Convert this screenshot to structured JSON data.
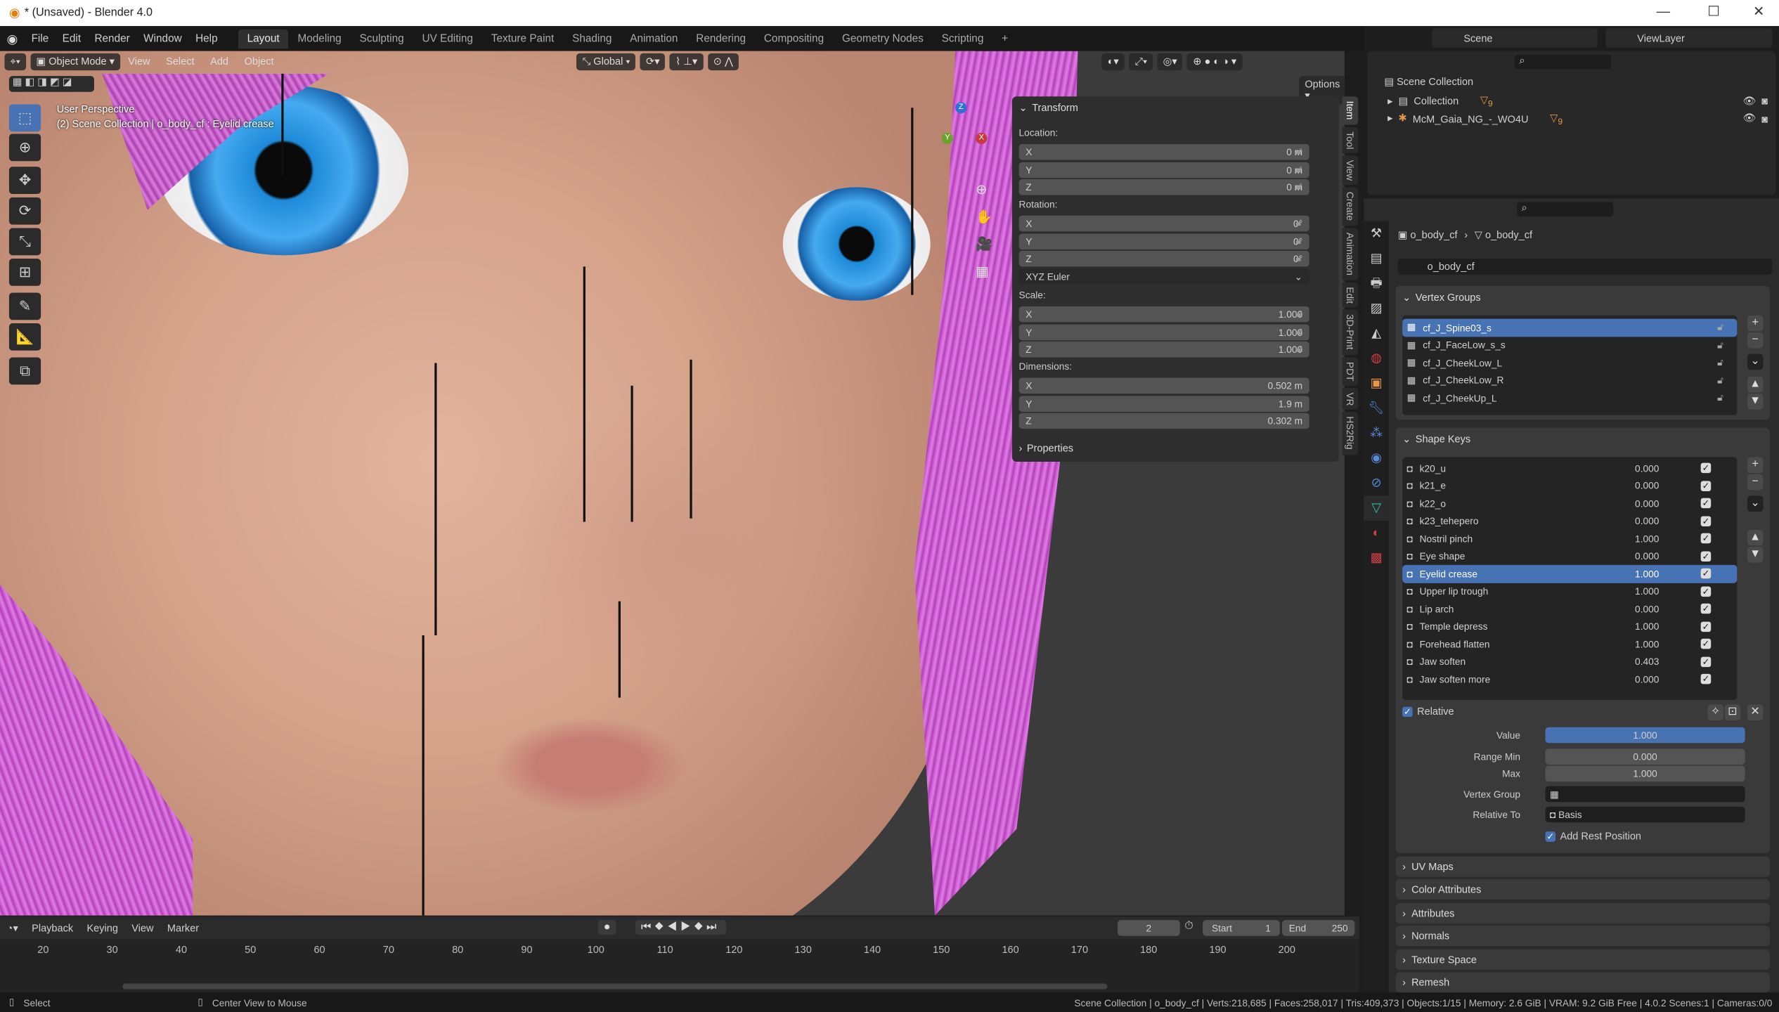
{
  "window": {
    "title": "* (Unsaved) - Blender 4.0",
    "minimize": "—",
    "maximize": "☐",
    "close": "✕"
  },
  "menu": {
    "items": [
      "File",
      "Edit",
      "Render",
      "Window",
      "Help"
    ],
    "workspaces": [
      "Layout",
      "Modeling",
      "Sculpting",
      "UV Editing",
      "Texture Paint",
      "Shading",
      "Animation",
      "Rendering",
      "Compositing",
      "Geometry Nodes",
      "Scripting"
    ],
    "active_workspace": "Layout",
    "add": "+"
  },
  "viewport": {
    "mode": "Object Mode",
    "menus": [
      "View",
      "Select",
      "Add",
      "Object"
    ],
    "orientation": "Global",
    "options": "Options",
    "perspective": "User Perspective",
    "info": "(2) Scene Collection | o_body_cf : Eyelid crease",
    "gizmo": {
      "z": "Z",
      "y": "Y",
      "x": "X"
    }
  },
  "npanel": {
    "title": "Transform",
    "location_label": "Location:",
    "rotation_label": "Rotation:",
    "scale_label": "Scale:",
    "dimensions_label": "Dimensions:",
    "location": [
      {
        "axis": "X",
        "value": "0 m"
      },
      {
        "axis": "Y",
        "value": "0 m"
      },
      {
        "axis": "Z",
        "value": "0 m"
      }
    ],
    "rotation": [
      {
        "axis": "X",
        "value": "0°"
      },
      {
        "axis": "Y",
        "value": "0°"
      },
      {
        "axis": "Z",
        "value": "0°"
      }
    ],
    "rotation_mode": "XYZ Euler",
    "scale": [
      {
        "axis": "X",
        "value": "1.000"
      },
      {
        "axis": "Y",
        "value": "1.000"
      },
      {
        "axis": "Z",
        "value": "1.000"
      }
    ],
    "dimensions": [
      {
        "axis": "X",
        "value": "0.502 m"
      },
      {
        "axis": "Y",
        "value": "1.9 m"
      },
      {
        "axis": "Z",
        "value": "0.302 m"
      }
    ],
    "properties": "Properties",
    "tabs": [
      "Item",
      "Tool",
      "View",
      "Create",
      "Animation",
      "Edit",
      "3D-Print",
      "PDT",
      "VR",
      "HS2Rig"
    ],
    "active_tab": "Item"
  },
  "topright": {
    "scene": "Scene",
    "viewlayer": "ViewLayer"
  },
  "outliner": {
    "scene_collection": "Scene Collection",
    "rows": [
      {
        "name": "Collection",
        "badge": "9"
      },
      {
        "name": "McM_Gaia_NG_-_WO4U",
        "badge": "9"
      }
    ]
  },
  "properties": {
    "breadcrumb": [
      "o_body_cf",
      "o_body_cf"
    ],
    "mesh_name": "o_body_cf",
    "vertex_groups_title": "Vertex Groups",
    "vertex_groups": [
      "cf_J_Spine03_s",
      "cf_J_FaceLow_s_s",
      "cf_J_CheekLow_L",
      "cf_J_CheekLow_R",
      "cf_J_CheekUp_L"
    ],
    "vertex_group_selected": 0,
    "shape_keys_title": "Shape Keys",
    "shape_keys": [
      {
        "name": "k20_u",
        "value": "0.000"
      },
      {
        "name": "k21_e",
        "value": "0.000"
      },
      {
        "name": "k22_o",
        "value": "0.000"
      },
      {
        "name": "k23_tehepero",
        "value": "0.000"
      },
      {
        "name": "Nostril pinch",
        "value": "1.000"
      },
      {
        "name": "Eye shape",
        "value": "0.000"
      },
      {
        "name": "Eyelid crease",
        "value": "1.000"
      },
      {
        "name": "Upper lip trough",
        "value": "1.000"
      },
      {
        "name": "Lip arch",
        "value": "0.000"
      },
      {
        "name": "Temple depress",
        "value": "1.000"
      },
      {
        "name": "Forehead flatten",
        "value": "1.000"
      },
      {
        "name": "Jaw soften",
        "value": "0.403"
      },
      {
        "name": "Jaw soften more",
        "value": "0.000"
      }
    ],
    "shape_key_selected": 6,
    "relative": "Relative",
    "value_label": "Value",
    "value": "1.000",
    "value_fraction": 1.0,
    "range_min_label": "Range Min",
    "range_min": "0.000",
    "max_label": "Max",
    "max": "1.000",
    "vertex_group_label": "Vertex Group",
    "vertex_group_value": "",
    "relative_to_label": "Relative To",
    "relative_to": "Basis",
    "add_rest_position": "Add Rest Position",
    "collapsed_panels": [
      "UV Maps",
      "Color Attributes",
      "Attributes",
      "Normals",
      "Texture Space",
      "Remesh"
    ]
  },
  "timeline": {
    "menus": [
      "Playback",
      "Keying",
      "View",
      "Marker"
    ],
    "current_frame": "2",
    "start_label": "Start",
    "start": "1",
    "end_label": "End",
    "end": "250",
    "ticks": [
      "20",
      "30",
      "40",
      "50",
      "60",
      "70",
      "80",
      "90",
      "100",
      "110",
      "120",
      "130",
      "140",
      "150",
      "160",
      "170",
      "180",
      "190",
      "200"
    ]
  },
  "status": {
    "left": [
      "Select",
      "Center View to Mouse"
    ],
    "right": "Scene Collection | o_body_cf | Verts:218,685 | Faces:258,017 | Tris:409,373 | Objects:1/15 | Memory: 2.6 GiB | VRAM: 9.2 GiB Free | 4.0.2   Scenes:1 | Cameras:0/0"
  },
  "colors": {
    "accent": "#4772b3",
    "selection_outline": "#f0a030",
    "hair": "#d066d6",
    "mesh_data_icon": "#2ec4a0"
  }
}
